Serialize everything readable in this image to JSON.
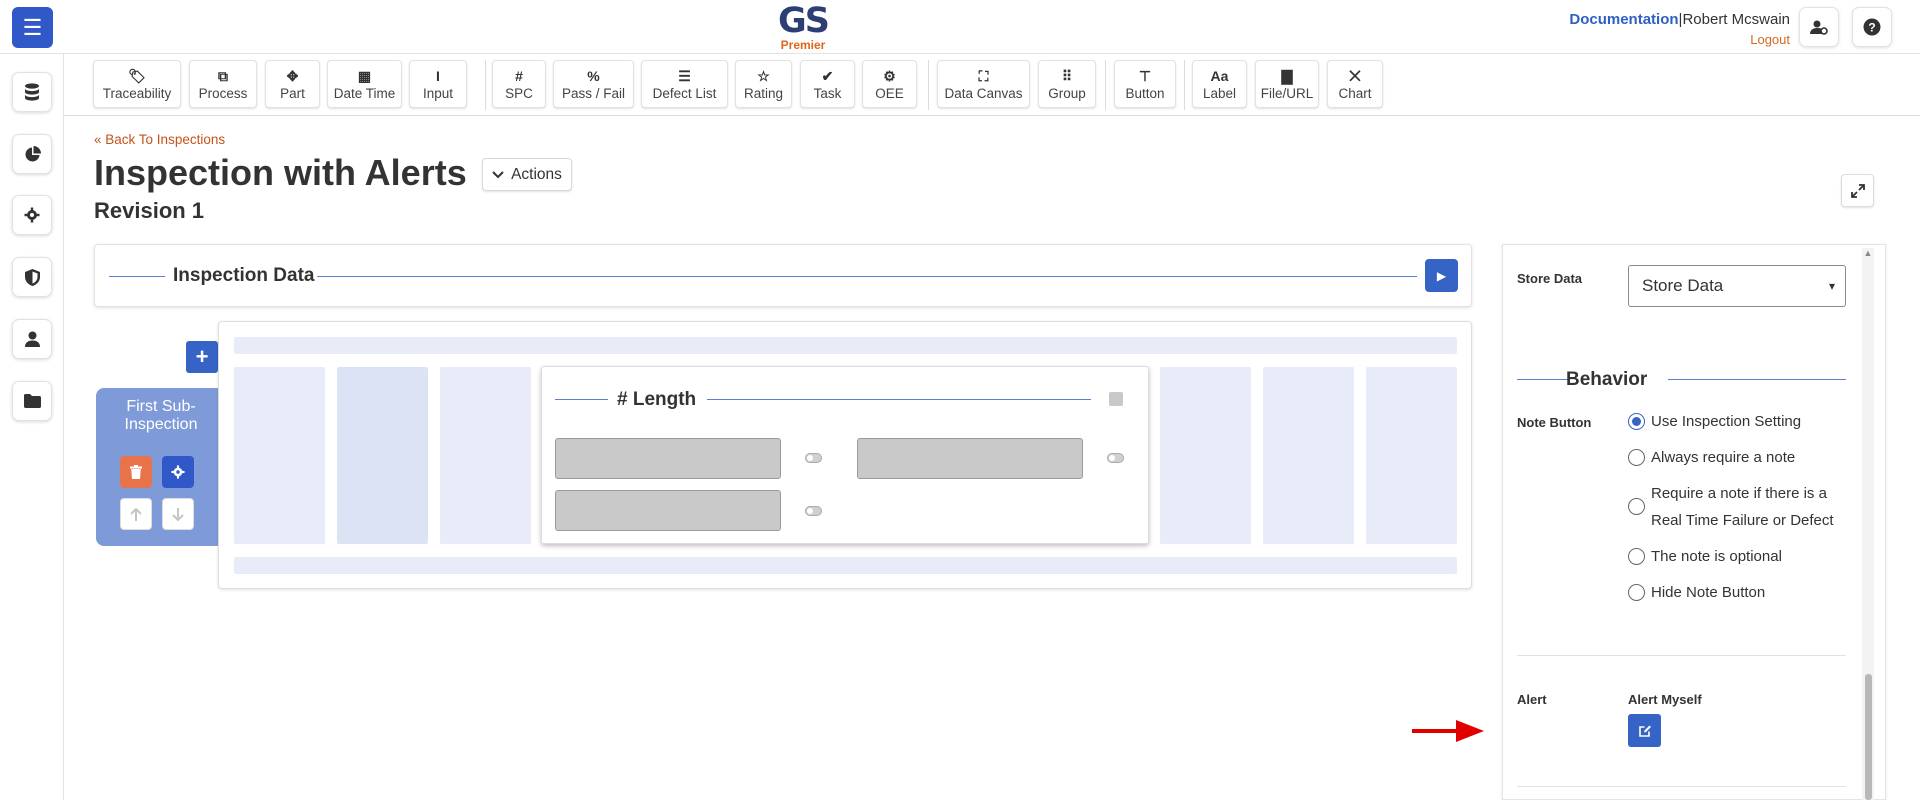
{
  "header": {
    "logo_main": "GS",
    "logo_sub": "Premier",
    "documentation_link": "Documentation",
    "separator": "|",
    "user_name": "Robert Mcswain",
    "logout_label": "Logout",
    "icons": [
      "menu-icon",
      "user-settings-icon",
      "help-icon"
    ]
  },
  "sidebar": {
    "items": [
      {
        "icon": "database-icon"
      },
      {
        "icon": "pie-chart-icon"
      },
      {
        "icon": "gear-icon"
      },
      {
        "icon": "shield-icon"
      },
      {
        "icon": "user-icon"
      },
      {
        "icon": "folder-icon"
      }
    ]
  },
  "toolbar": {
    "tools": [
      {
        "label": "Traceability",
        "icon": "tag-icon",
        "glyph": "🏷"
      },
      {
        "label": "Process",
        "icon": "process-icon",
        "glyph": "⧉"
      },
      {
        "label": "Part",
        "icon": "puzzle-icon",
        "glyph": "✥"
      },
      {
        "label": "Date Time",
        "icon": "calendar-icon",
        "glyph": "▦"
      },
      {
        "label": "Input",
        "icon": "text-cursor-icon",
        "glyph": "I"
      },
      {
        "label": "SPC",
        "icon": "hash-icon",
        "glyph": "#"
      },
      {
        "label": "Pass / Fail",
        "icon": "percent-icon",
        "glyph": "%"
      },
      {
        "label": "Defect List",
        "icon": "list-icon",
        "glyph": "☰"
      },
      {
        "label": "Rating",
        "icon": "star-icon",
        "glyph": "☆"
      },
      {
        "label": "Task",
        "icon": "clipboard-check-icon",
        "glyph": "✔"
      },
      {
        "label": "OEE",
        "icon": "robot-arm-icon",
        "glyph": "⚙"
      },
      {
        "label": "Data Canvas",
        "icon": "canvas-icon",
        "glyph": "⛶"
      },
      {
        "label": "Group",
        "icon": "grid-icon",
        "glyph": "⠿"
      },
      {
        "label": "Button",
        "icon": "paint-roller-icon",
        "glyph": "⊤"
      },
      {
        "label": "Label",
        "icon": "font-icon",
        "glyph": "Aa"
      },
      {
        "label": "File/URL",
        "icon": "file-icon",
        "glyph": "▇"
      },
      {
        "label": "Chart",
        "icon": "chart-icon",
        "glyph": "⨉"
      }
    ]
  },
  "page": {
    "back_link": "Back To Inspections",
    "title": "Inspection with Alerts",
    "actions_label": "Actions",
    "revision": "Revision 1"
  },
  "inspection_panel": {
    "title": "Inspection Data"
  },
  "sub_inspection": {
    "title": "First Sub-Inspection"
  },
  "length_card": {
    "title": "# Length"
  },
  "properties": {
    "store_data_label": "Store Data",
    "store_data_value": "Store Data",
    "behavior_title": "Behavior",
    "note_button_label": "Note Button",
    "note_options": [
      {
        "label": "Use Inspection Setting",
        "checked": true
      },
      {
        "label": "Always require a note",
        "checked": false
      },
      {
        "label": "Require a note if there is a",
        "label2": "Real Time Failure or Defect",
        "checked": false
      },
      {
        "label": "The note is optional",
        "checked": false
      },
      {
        "label": "Hide Note Button",
        "checked": false
      }
    ],
    "alert_label": "Alert",
    "alert_myself_label": "Alert Myself"
  },
  "colors": {
    "primary": "#3563c6",
    "accent_orange": "#e3651d",
    "danger": "#e8724a",
    "sub_card": "#7f9ad8",
    "annotation_arrow": "#e00000"
  }
}
